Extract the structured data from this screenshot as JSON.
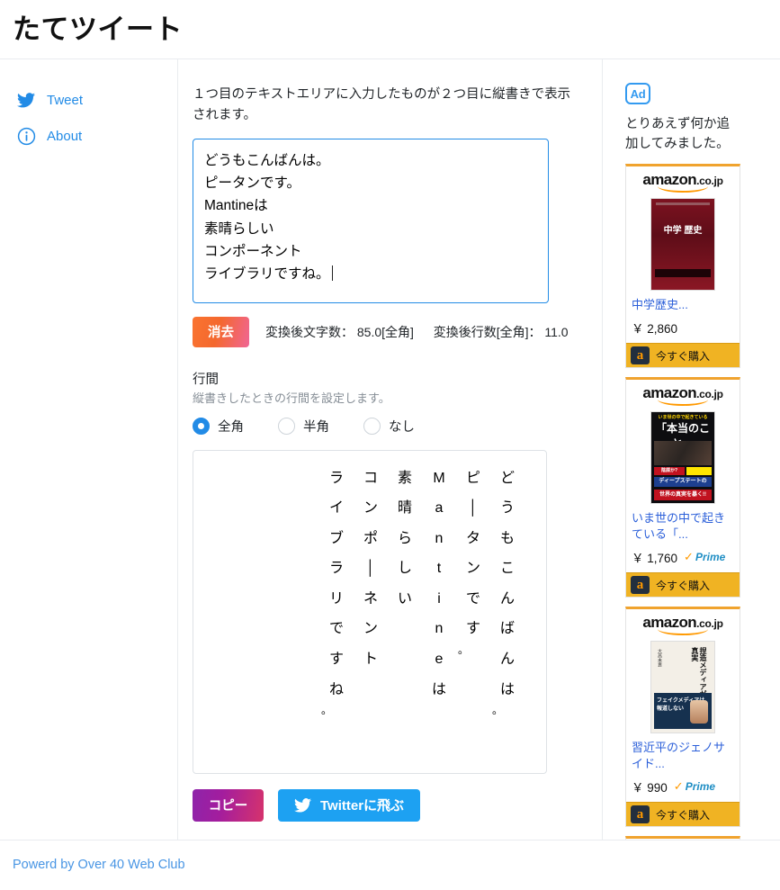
{
  "header": {
    "title": "たてツイート"
  },
  "sidebar": {
    "items": [
      {
        "label": "Tweet",
        "icon": "twitter-bird-icon"
      },
      {
        "label": "About",
        "icon": "info-circle-icon"
      }
    ]
  },
  "main": {
    "lead": "１つ目のテキストエリアに入力したものが２つ目に縦書きで表示されます。",
    "input_lines": [
      "どうもこんばんは。",
      "ピータンです。",
      "Mantineは",
      "素晴らしい",
      "コンポーネント",
      "ライブラリですね。"
    ],
    "clear_button": "消去",
    "counts": {
      "chars_label": "変換後文字数：",
      "chars_value": "85.0[全角]",
      "lines_label": "変換後行数[全角]：",
      "lines_value": "11.0"
    },
    "spacing": {
      "label": "行間",
      "description": "縦書きしたときの行間を設定します。",
      "options": [
        {
          "label": "全角",
          "selected": true
        },
        {
          "label": "半角",
          "selected": false
        },
        {
          "label": "なし",
          "selected": false
        }
      ]
    },
    "vertical_columns": [
      "どうもこんばんは。",
      "ピータンです。",
      "Mantineは",
      "素晴らしい",
      "コンポーネント",
      "ライブラリですね。"
    ],
    "copy_button": "コピー",
    "twitter_button": "Twitterに飛ぶ"
  },
  "ads": {
    "badge": "Ad",
    "note": "とりあえず何か追加してみました。",
    "brand": {
      "name": "amazon",
      "tld": ".co.jp"
    },
    "buy_label": "今すぐ購入",
    "prime_label": "Prime",
    "items": [
      {
        "title": "中学歴史...",
        "price": "￥ 2,860",
        "prime": false,
        "cover": "cover-1",
        "cover_text": "中学 歴史"
      },
      {
        "title": "いま世の中で起きている「...",
        "price": "￥ 1,760",
        "prime": true,
        "cover": "cover-2",
        "cover_text": "「本当のこと」"
      },
      {
        "title": "習近平のジェノサイド...",
        "price": "￥ 990",
        "prime": true,
        "cover": "cover-3",
        "cover_text": "捏造メディアが報じない真実"
      },
      {
        "title": "",
        "price": "",
        "prime": false,
        "cover": "cover-1",
        "cover_text": ""
      }
    ]
  },
  "footer": {
    "credit": "Powerd by Over 40 Web Club"
  },
  "colors": {
    "accent_blue": "#228be6",
    "twitter_blue": "#1da1f2",
    "amazon_orange": "#f0b323",
    "clear_gradient_start": "#fa7430",
    "clear_gradient_end": "#f06595",
    "copy_gradient_start": "#8e24aa",
    "copy_gradient_end": "#d6336c"
  }
}
